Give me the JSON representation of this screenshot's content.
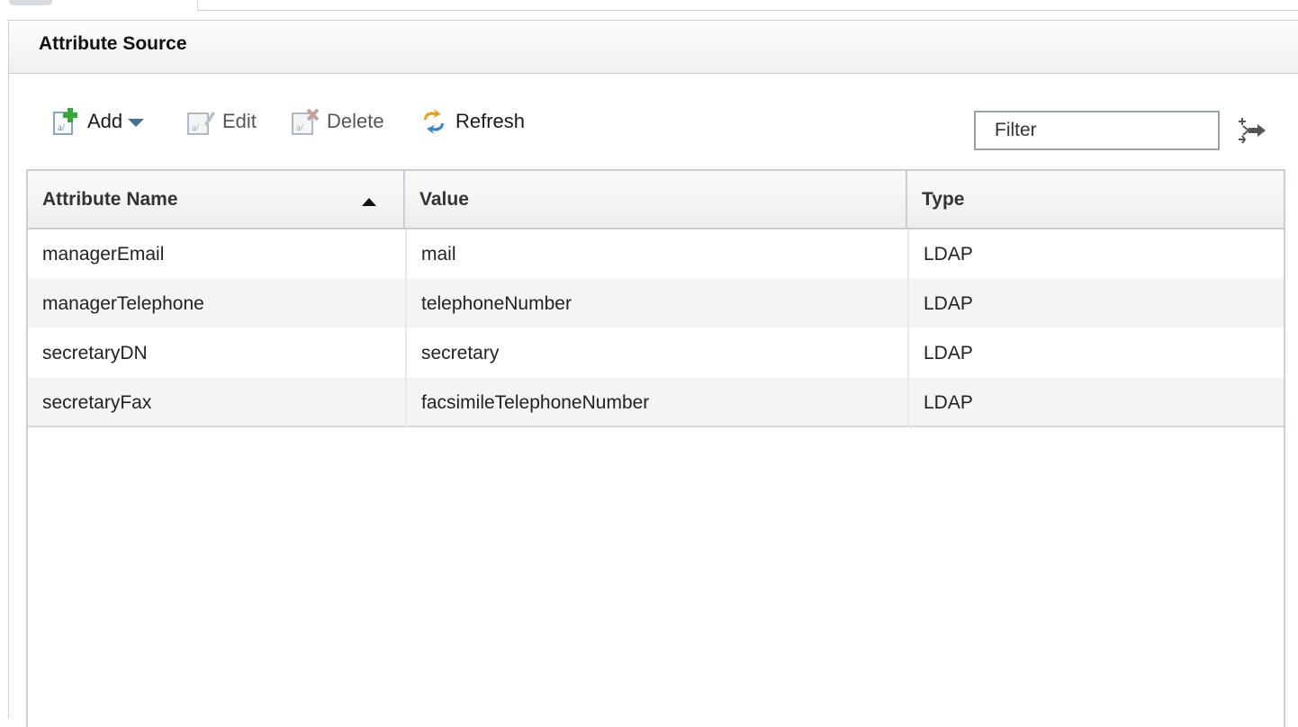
{
  "panel": {
    "title": "Attribute Source"
  },
  "toolbar": {
    "add_label": "Add",
    "edit_label": "Edit",
    "delete_label": "Delete",
    "refresh_label": "Refresh",
    "filter_placeholder": "Filter"
  },
  "table": {
    "columns": [
      "Attribute Name",
      "Value",
      "Type"
    ],
    "sort": {
      "column": "Attribute Name",
      "direction": "ascending"
    },
    "rows": [
      {
        "name": "managerEmail",
        "value": "mail",
        "type": "LDAP"
      },
      {
        "name": "managerTelephone",
        "value": "telephoneNumber",
        "type": "LDAP"
      },
      {
        "name": "secretaryDN",
        "value": "secretary",
        "type": "LDAP"
      },
      {
        "name": "secretaryFax",
        "value": "facsimileTelephoneNumber",
        "type": "LDAP"
      }
    ]
  },
  "icons": {
    "add": "add-attribute-icon",
    "edit": "edit-attribute-icon",
    "delete": "delete-attribute-icon",
    "refresh": "refresh-icon",
    "filter_go": "apply-filter-icon",
    "sort": "sort-ascending-icon"
  },
  "colors": {
    "add_plus": "#3aa53a",
    "delete_x": "#c0392b",
    "caret": "#4a6f95"
  }
}
